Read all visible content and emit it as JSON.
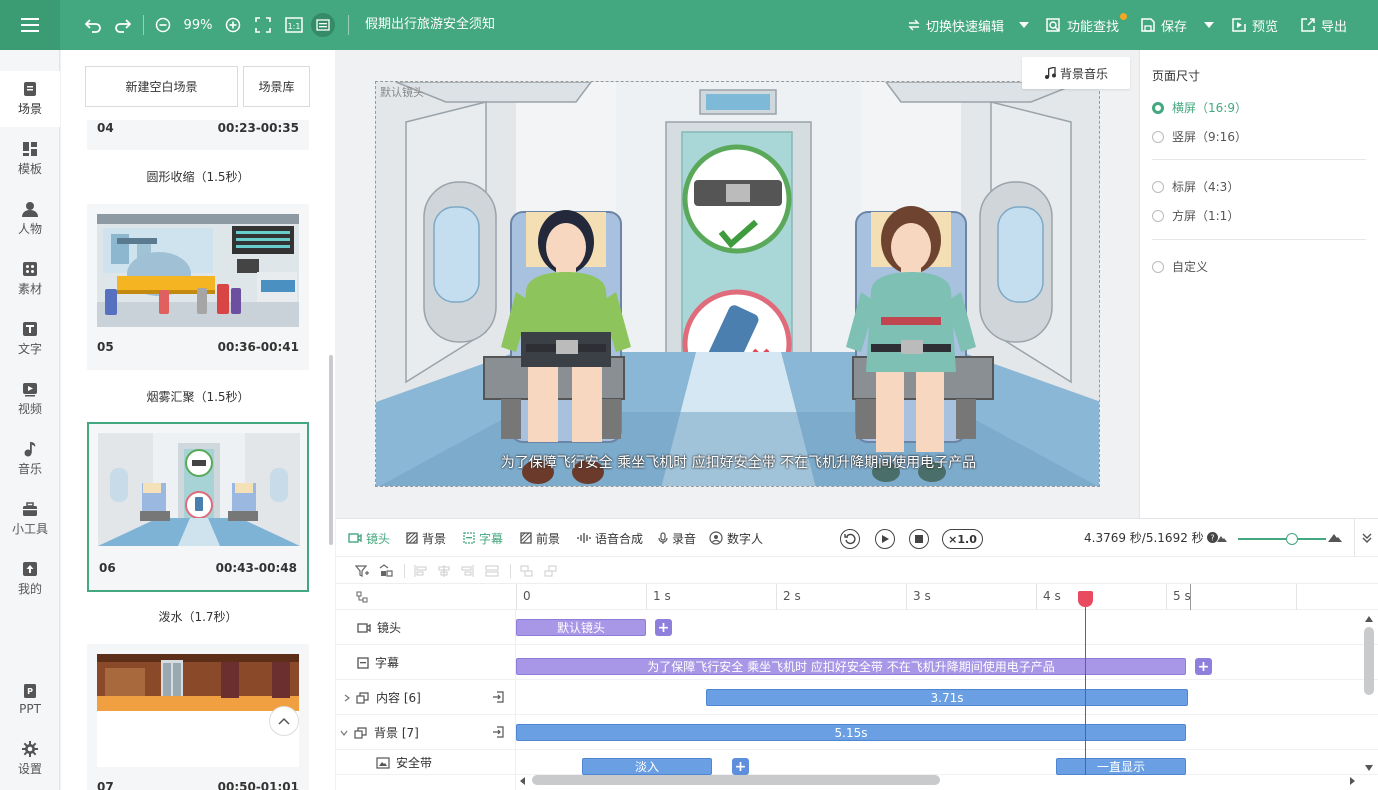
{
  "topbar": {
    "zoom": "99%",
    "doc_title": "假期出行旅游安全须知",
    "switch_edit": "切换快速编辑",
    "feature_search": "功能查找",
    "save": "保存",
    "preview": "预览",
    "export": "导出",
    "accent": "#43a77f"
  },
  "nav": {
    "items": [
      {
        "label": "场景",
        "icon": "scene-icon"
      },
      {
        "label": "模板",
        "icon": "template-icon"
      },
      {
        "label": "人物",
        "icon": "person-icon"
      },
      {
        "label": "素材",
        "icon": "material-icon"
      },
      {
        "label": "文字",
        "icon": "text-icon"
      },
      {
        "label": "视频",
        "icon": "video-icon"
      },
      {
        "label": "音乐",
        "icon": "music-icon"
      },
      {
        "label": "小工具",
        "icon": "toolbox-icon"
      },
      {
        "label": "我的",
        "icon": "upload-icon"
      },
      {
        "label": "PPT",
        "icon": "ppt-icon"
      },
      {
        "label": "设置",
        "icon": "gear-icon"
      }
    ]
  },
  "scenes": {
    "new_blank": "新建空白场景",
    "library": "场景库",
    "list": [
      {
        "num": "04",
        "time": "00:23-00:35",
        "transition": "圆形收缩（1.5秒）"
      },
      {
        "num": "05",
        "time": "00:36-00:41",
        "transition": "烟雾汇聚（1.5秒）"
      },
      {
        "num": "06",
        "time": "00:43-00:48",
        "transition": "泼水（1.7秒）"
      },
      {
        "num": "07",
        "time": "00:50-01:01"
      }
    ]
  },
  "canvas": {
    "bg_music": "背景音乐",
    "lens_label": "默认镜头",
    "caption": "为了保障飞行安全 乘坐飞机时 应扣好安全带 不在飞机升降期间使用电子产品"
  },
  "props": {
    "heading": "页面尺寸",
    "options": [
      "横屏（16:9）",
      "竖屏（9:16）",
      "标屏（4:3）",
      "方屏（1:1）",
      "自定义"
    ],
    "selected": "横屏（16:9）"
  },
  "timeline": {
    "tabs": [
      "镜头",
      "背景",
      "字幕",
      "前景",
      "语音合成",
      "录音",
      "数字人"
    ],
    "speed": "×1.0",
    "time_info": "4.3769 秒/5.1692 秒",
    "ticks": [
      "0",
      "1 s",
      "2 s",
      "3 s",
      "4 s",
      "5 s"
    ],
    "playhead_seconds": 4.3769,
    "tracks": [
      {
        "name": "镜头",
        "clip": "默认镜头"
      },
      {
        "name": "字幕",
        "clip": "为了保障飞行安全 乘坐飞机时 应扣好安全带 不在飞机升降期间使用电子产品"
      },
      {
        "name": "内容 [6]",
        "clip": "3.71s"
      },
      {
        "name": "背景 [7]",
        "clip": "5.15s"
      },
      {
        "name": "安全带",
        "clip1": "淡入",
        "clip2": "一直显示"
      }
    ]
  }
}
